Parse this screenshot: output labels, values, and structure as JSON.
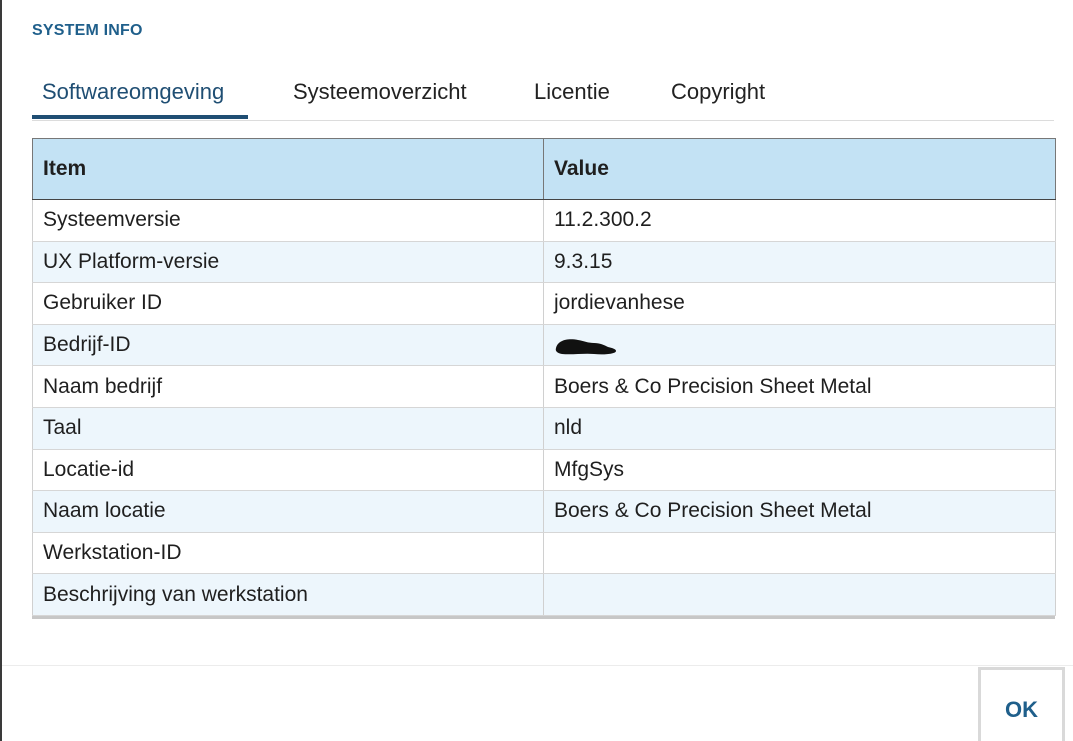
{
  "dialog": {
    "title": "SYSTEM INFO"
  },
  "tabs": [
    {
      "label": "Softwareomgeving",
      "active": true
    },
    {
      "label": "Systeemoverzicht",
      "active": false
    },
    {
      "label": "Licentie",
      "active": false
    },
    {
      "label": "Copyright",
      "active": false
    }
  ],
  "grid": {
    "columns": [
      "Item",
      "Value"
    ],
    "rows": [
      {
        "item": "Systeemversie",
        "value": "11.2.300.2"
      },
      {
        "item": "UX Platform-versie",
        "value": "9.3.15"
      },
      {
        "item": "Gebruiker ID",
        "value": "jordievanhese"
      },
      {
        "item": "Bedrijf-ID",
        "value": ""
      },
      {
        "item": "Naam bedrijf",
        "value": "Boers & Co Precision Sheet Metal"
      },
      {
        "item": "Taal",
        "value": "nld"
      },
      {
        "item": "Locatie-id",
        "value": "MfgSys"
      },
      {
        "item": "Naam locatie",
        "value": "Boers & Co Precision Sheet Metal"
      },
      {
        "item": "Werkstation-ID",
        "value": ""
      },
      {
        "item": "Beschrijving van werkstation",
        "value": ""
      }
    ]
  },
  "footer": {
    "ok_label": "OK"
  },
  "colors": {
    "accent": "#1f5f8b",
    "tab_active": "#1f4e73",
    "header_bg": "#c3e2f4",
    "row_alt_bg": "#edf6fc"
  }
}
